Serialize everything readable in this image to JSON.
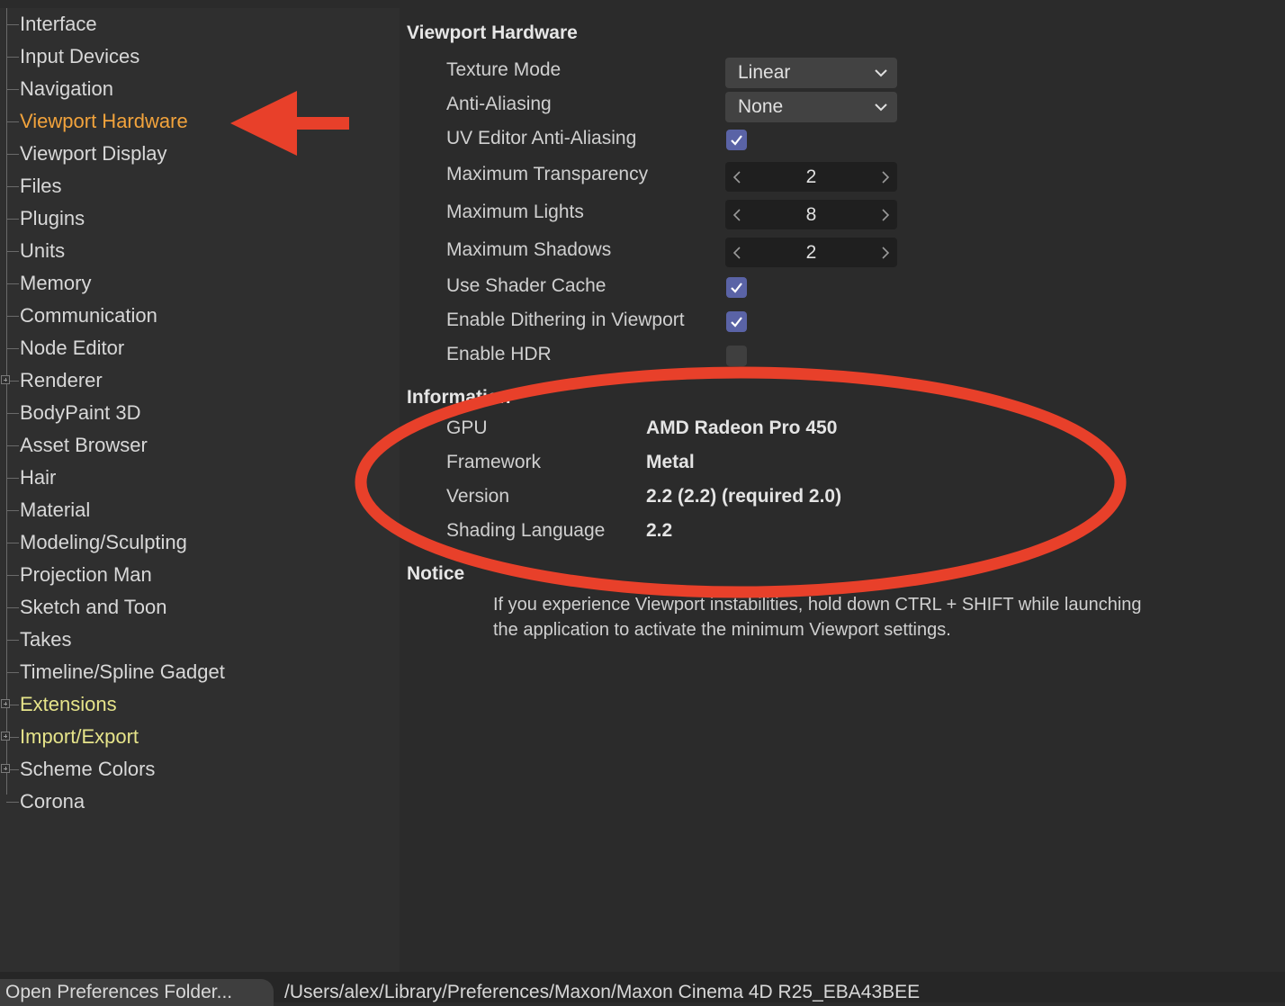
{
  "sidebar": {
    "items": [
      {
        "label": "Interface"
      },
      {
        "label": "Input Devices"
      },
      {
        "label": "Navigation"
      },
      {
        "label": "Viewport Hardware",
        "selected": true
      },
      {
        "label": "Viewport Display"
      },
      {
        "label": "Files"
      },
      {
        "label": "Plugins"
      },
      {
        "label": "Units"
      },
      {
        "label": "Memory"
      },
      {
        "label": "Communication"
      },
      {
        "label": "Node Editor"
      },
      {
        "label": "Renderer",
        "expandable": true
      },
      {
        "label": "BodyPaint 3D"
      },
      {
        "label": "Asset Browser"
      },
      {
        "label": "Hair"
      },
      {
        "label": "Material"
      },
      {
        "label": "Modeling/Sculpting"
      },
      {
        "label": "Projection Man"
      },
      {
        "label": "Sketch and Toon"
      },
      {
        "label": "Takes"
      },
      {
        "label": "Timeline/Spline Gadget"
      },
      {
        "label": "Extensions",
        "expandable": true,
        "plugin": true
      },
      {
        "label": "Import/Export",
        "expandable": true,
        "plugin": true
      },
      {
        "label": "Scheme Colors",
        "expandable": true
      },
      {
        "label": "Corona"
      }
    ]
  },
  "viewport_hardware": {
    "title": "Viewport Hardware",
    "texture_mode": {
      "label": "Texture Mode",
      "value": "Linear"
    },
    "anti_aliasing": {
      "label": "Anti-Aliasing",
      "value": "None"
    },
    "uv_editor_aa": {
      "label": "UV Editor Anti-Aliasing",
      "checked": true
    },
    "max_transparency": {
      "label": "Maximum Transparency",
      "value": "2"
    },
    "max_lights": {
      "label": "Maximum Lights",
      "value": "8"
    },
    "max_shadows": {
      "label": "Maximum Shadows",
      "value": "2"
    },
    "use_shader_cache": {
      "label": "Use Shader Cache",
      "checked": true
    },
    "enable_dithering": {
      "label": "Enable Dithering in Viewport",
      "checked": true
    },
    "enable_hdr": {
      "label": "Enable HDR",
      "checked": false
    }
  },
  "information": {
    "title": "Information",
    "gpu": {
      "label": "GPU",
      "value": "AMD Radeon Pro 450"
    },
    "framework": {
      "label": "Framework",
      "value": "Metal"
    },
    "version": {
      "label": "Version",
      "value": "2.2 (2.2) (required 2.0)"
    },
    "shading_language": {
      "label": "Shading Language",
      "value": "2.2"
    }
  },
  "notice": {
    "title": "Notice",
    "line1": "If you experience Viewport instabilities, hold down CTRL + SHIFT while launching",
    "line2": "the application to activate the minimum Viewport settings."
  },
  "statusbar": {
    "open_folder_label": "Open Preferences Folder...",
    "path": "/Users/alex/Library/Preferences/Maxon/Maxon Cinema 4D R25_EBA43BEE"
  },
  "colors": {
    "selected_item": "#f2a33c",
    "plugin_item": "#e6e48a",
    "checkbox_on": "#5a63a6",
    "annotation_red": "#e8402a"
  }
}
